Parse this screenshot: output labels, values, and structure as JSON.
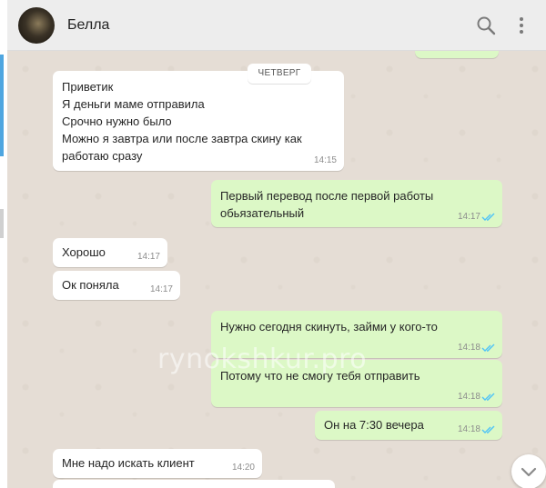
{
  "contact": {
    "name": "Белла"
  },
  "header_icons": [
    "search-icon",
    "menu-dots-icon"
  ],
  "day_label": "ЧЕТВЕРГ",
  "messages": [
    {
      "direction": "in",
      "lines": [
        "Приветик",
        "Я деньги маме отправила",
        "Срочно нужно было",
        "Можно я завтра или после завтра скину как",
        "работаю сразу"
      ],
      "time": "14:15"
    },
    {
      "direction": "out",
      "lines": [
        "Первый перевод после первой работы",
        "обьязательный"
      ],
      "time": "14:17",
      "status": "read"
    },
    {
      "direction": "in",
      "lines": [
        "Хорошо"
      ],
      "time": "14:17"
    },
    {
      "direction": "in",
      "lines": [
        "Ок поняла"
      ],
      "time": "14:17"
    },
    {
      "direction": "out",
      "lines": [
        "Нужно сегодня скинуть, займи у кого-то"
      ],
      "time": "14:18",
      "status": "read"
    },
    {
      "direction": "out",
      "lines": [
        "Потому что не смогу тебя отправить"
      ],
      "time": "14:18",
      "status": "read"
    },
    {
      "direction": "out",
      "lines": [
        "Он на 7:30 вечера"
      ],
      "time": "14:18",
      "status": "read"
    },
    {
      "direction": "in",
      "lines": [
        "Мне надо искать клиент"
      ],
      "time": "14:20"
    }
  ],
  "watermark": "rynokshkur.pro",
  "colors": {
    "incoming": "#ffffff",
    "outgoing": "#dcf8c6",
    "chat_bg": "#e5ddd5",
    "read_ticks": "#4fc3f7"
  }
}
